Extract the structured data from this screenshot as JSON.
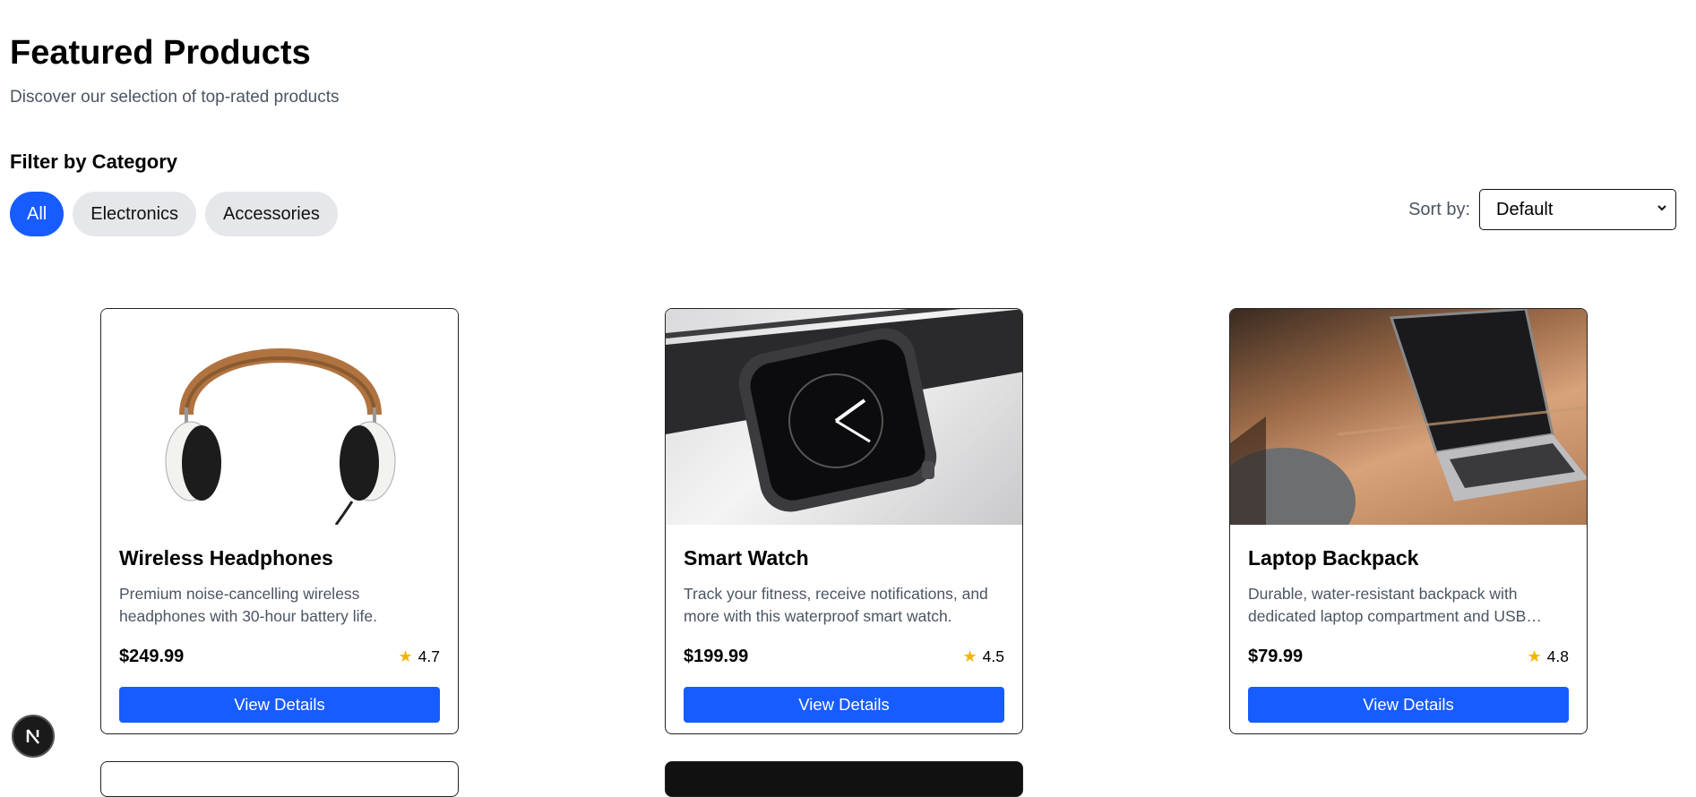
{
  "header": {
    "title": "Featured Products",
    "subtitle": "Discover our selection of top-rated products"
  },
  "filter": {
    "heading": "Filter by Category",
    "categories": [
      {
        "label": "All",
        "active": true
      },
      {
        "label": "Electronics",
        "active": false
      },
      {
        "label": "Accessories",
        "active": false
      }
    ]
  },
  "sort": {
    "label": "Sort by:",
    "selected": "Default"
  },
  "products": [
    {
      "name": "Wireless Headphones",
      "description": "Premium noise-cancelling wireless headphones with 30-hour battery life.",
      "price": "$249.99",
      "rating": "4.7",
      "button_label": "View Details",
      "image": "headphones-photo"
    },
    {
      "name": "Smart Watch",
      "description": "Track your fitness, receive notifications, and more with this waterproof smart watch.",
      "price": "$199.99",
      "rating": "4.5",
      "button_label": "View Details",
      "image": "smart-watch-photo"
    },
    {
      "name": "Laptop Backpack",
      "description": "Durable, water-resistant backpack with dedicated laptop compartment and USB…",
      "price": "$79.99",
      "rating": "4.8",
      "button_label": "View Details",
      "image": "laptop-photo"
    }
  ],
  "icons": {
    "star": "star-icon",
    "dev_badge": "nextjs-logo-icon",
    "sort_chevron": "chevron-down-icon"
  },
  "colors": {
    "accent": "#175cff",
    "chip_inactive": "#e5e7eb",
    "star": "#f5b400",
    "muted_text": "#4b5563"
  }
}
